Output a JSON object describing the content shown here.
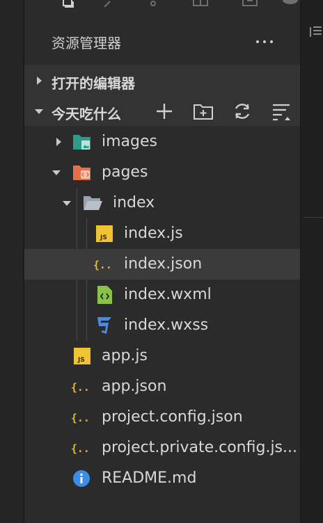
{
  "explorer": {
    "title": "资源管理器",
    "more_icon": "more-horizontal-icon",
    "sections": {
      "open_editors": "打开的编辑器",
      "project": "今天吃什么"
    },
    "toolbar": [
      "new-file-icon",
      "new-folder-icon",
      "refresh-icon",
      "collapse-all-icon"
    ]
  },
  "tree": [
    {
      "name": "images",
      "icon": "folder-images-icon"
    },
    {
      "name": "pages",
      "icon": "folder-pages-icon"
    },
    {
      "name": "index",
      "icon": "folder-open-icon"
    },
    {
      "name": "index.js",
      "icon": "js-file-icon"
    },
    {
      "name": "index.json",
      "icon": "json-file-icon"
    },
    {
      "name": "index.wxml",
      "icon": "wxml-file-icon"
    },
    {
      "name": "index.wxss",
      "icon": "css-file-icon"
    },
    {
      "name": "app.js",
      "icon": "js-file-icon"
    },
    {
      "name": "app.json",
      "icon": "json-file-icon"
    },
    {
      "name": "project.config.json",
      "icon": "json-file-icon"
    },
    {
      "name": "project.private.config.js...",
      "icon": "json-file-icon"
    },
    {
      "name": "README.md",
      "icon": "info-icon"
    }
  ],
  "colors": {
    "js": "#f1c232",
    "json": "#e8b83a",
    "wxml": "#8bc34a",
    "css": "#4f8ad8",
    "info": "#3b8ee8",
    "folder_teal": "#2e9a8c",
    "folder_orange": "#e4704a",
    "folder_grey": "#9aa3ad"
  }
}
